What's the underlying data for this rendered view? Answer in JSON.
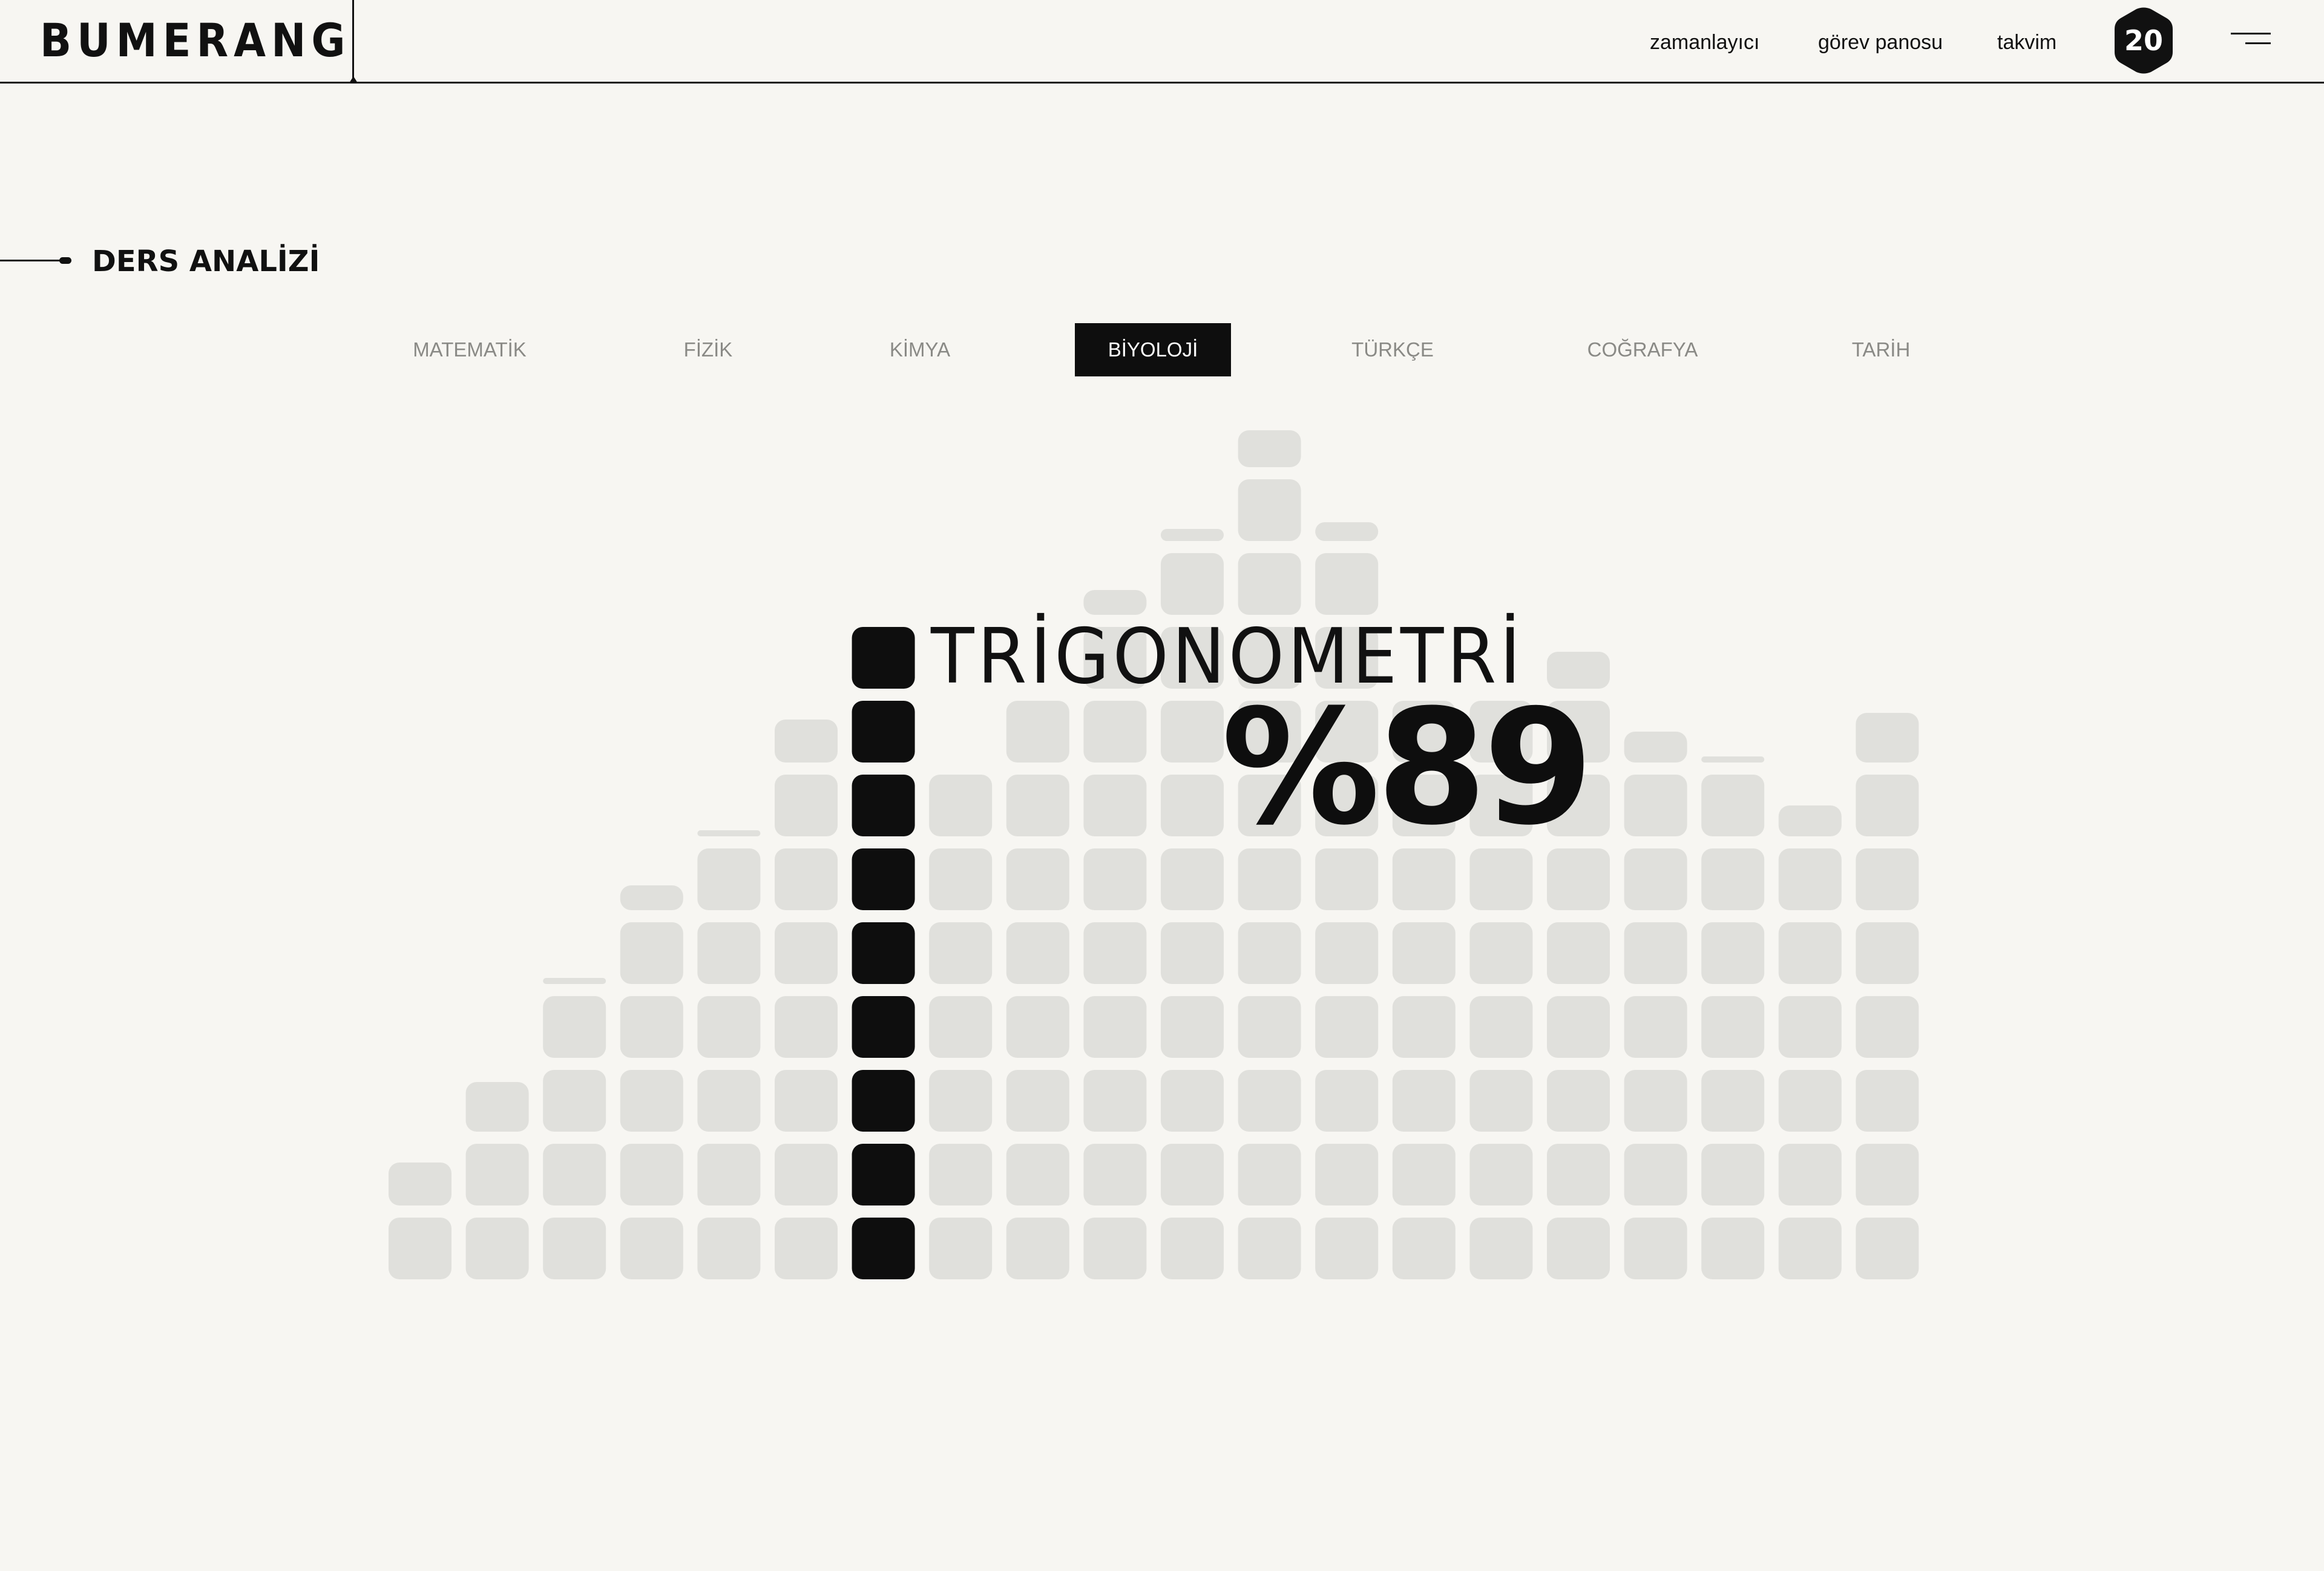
{
  "app": {
    "logo": "BUMERANG"
  },
  "nav": {
    "links": [
      "zamanlayıcı",
      "görev panosu",
      "takvim"
    ],
    "badge": "20"
  },
  "section": {
    "title": "DERS ANALİZİ"
  },
  "tabs": [
    {
      "label": "MATEMATİK",
      "active": false
    },
    {
      "label": "FİZİK",
      "active": false
    },
    {
      "label": "KİMYA",
      "active": false
    },
    {
      "label": "BİYOLOJİ",
      "active": true
    },
    {
      "label": "TÜRKÇE",
      "active": false
    },
    {
      "label": "COĞRAFYA",
      "active": false
    },
    {
      "label": "TARİH",
      "active": false
    }
  ],
  "chart_data": {
    "type": "bar",
    "title": "TRİGONOMETRİ",
    "highlight_label": "%89",
    "highlight_index": 6,
    "unit": "blocks",
    "values": [
      1.7,
      2.8,
      4.1,
      5.4,
      6.1,
      7.7,
      9,
      7,
      8,
      9.4,
      10.2,
      11.6,
      10.3,
      8,
      8,
      8.6,
      7.5,
      7.1,
      6.5,
      7.8
    ],
    "colors": {
      "highlight": "#0e0e0e",
      "block": "#e0e0dc"
    }
  }
}
